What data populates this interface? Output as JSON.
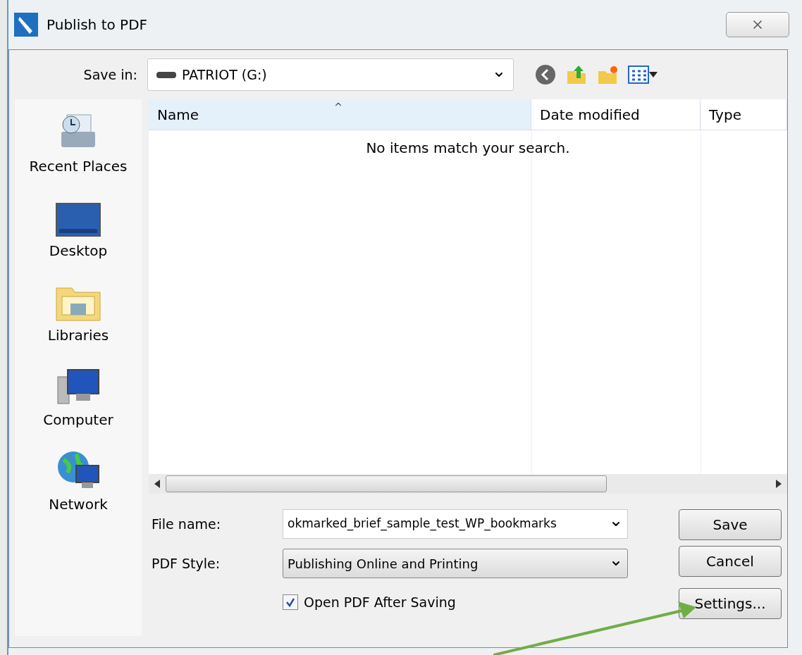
{
  "window": {
    "title": "Publish to PDF"
  },
  "save_in": {
    "label": "Save in:",
    "value": "PATRIOT (G:)"
  },
  "places": [
    {
      "kind": "recent",
      "label": "Recent Places"
    },
    {
      "kind": "desktop",
      "label": "Desktop"
    },
    {
      "kind": "libraries",
      "label": "Libraries"
    },
    {
      "kind": "computer",
      "label": "Computer"
    },
    {
      "kind": "network",
      "label": "Network"
    }
  ],
  "table": {
    "columns": [
      {
        "label": "Name",
        "sorted": true
      },
      {
        "label": "Date modified",
        "sorted": false
      },
      {
        "label": "Type",
        "sorted": false
      }
    ],
    "empty_message": "No items match your search."
  },
  "file_name": {
    "label": "File name:",
    "value": "okmarked_brief_sample_test_WP_bookmarks"
  },
  "pdf_style": {
    "label": "PDF Style:",
    "value": "Publishing Online and Printing"
  },
  "open_after": {
    "label": "Open PDF After Saving",
    "checked": true
  },
  "buttons": [
    {
      "label": "Save"
    },
    {
      "label": "Cancel"
    },
    {
      "label": "Settings..."
    }
  ],
  "annotation": {
    "kind": "arrow"
  }
}
